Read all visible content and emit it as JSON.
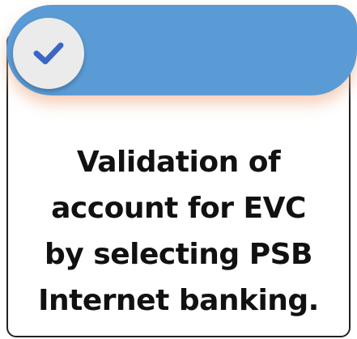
{
  "card": {
    "caption_lines": [
      "Validation of",
      "account for EVC",
      "by selecting PSB",
      "Internet banking."
    ]
  },
  "banner": {
    "color": "#5b9bd5",
    "icon": "checkmark-icon"
  }
}
